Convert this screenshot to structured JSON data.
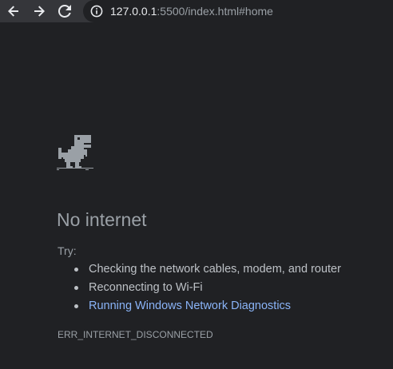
{
  "browser": {
    "url_host": "127.0.0.1",
    "url_rest": ":5500/index.html#home",
    "icons": {
      "back": "back-arrow-icon",
      "forward": "forward-arrow-icon",
      "reload": "reload-icon",
      "site_info": "info-icon"
    }
  },
  "error_page": {
    "title": "No internet",
    "try_label": "Try:",
    "suggestions": [
      "Checking the network cables, modem, and router",
      "Reconnecting to Wi-Fi",
      "Running Windows Network Diagnostics"
    ],
    "error_code": "ERR_INTERNET_DISCONNECTED",
    "illustration": "dinosaur-icon"
  },
  "colors": {
    "background": "#202124",
    "toolbar": "#35363a",
    "text_primary": "#9aa0a6",
    "text_list": "#bdc1c6",
    "link": "#8ab4f8"
  }
}
